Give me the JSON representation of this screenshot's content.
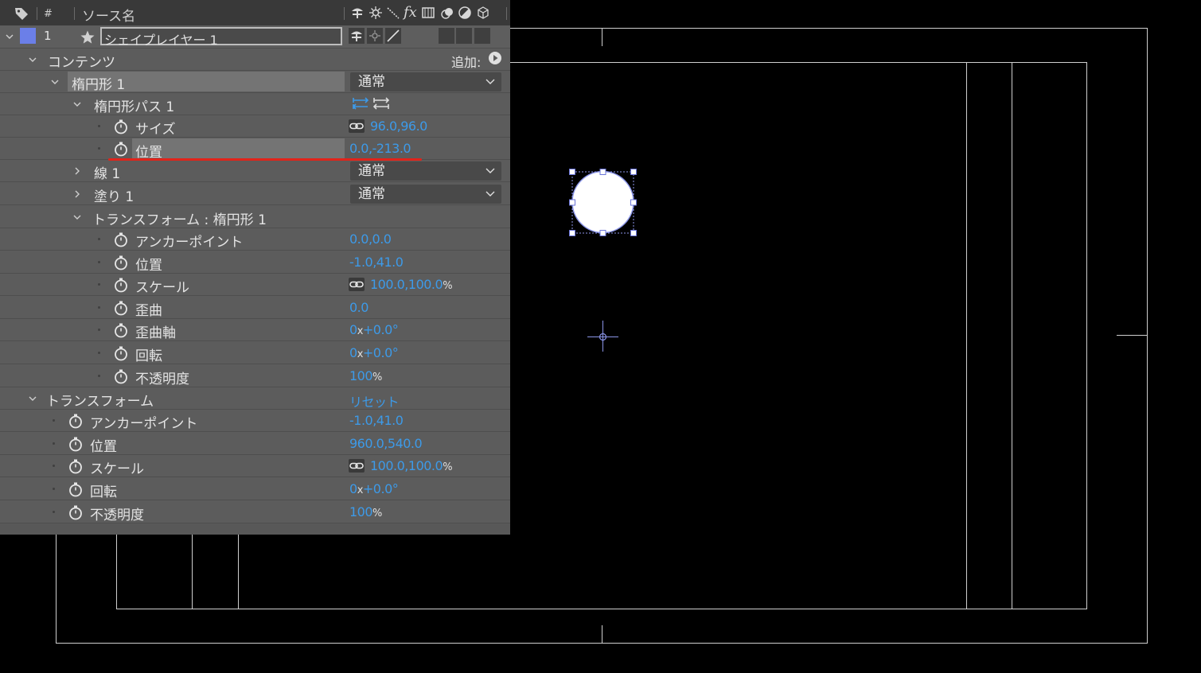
{
  "header": {
    "num_label": "#",
    "source_label": "ソース名"
  },
  "layer": {
    "number": "1",
    "name": "シェイプレイヤー 1",
    "color": "#6b7fe8"
  },
  "contents": {
    "label": "コンテンツ",
    "add_label": "追加:",
    "ellipse_group": {
      "label": "楕円形 1",
      "blend_mode": "通常",
      "path": {
        "label": "楕円形パス 1",
        "size_label": "サイズ",
        "size_value": "96.0,96.0",
        "position_label": "位置",
        "position_value": "0.0,-213.0"
      },
      "stroke": {
        "label": "線 1",
        "blend_mode": "通常"
      },
      "fill": {
        "label": "塗り 1",
        "blend_mode": "通常"
      },
      "transform": {
        "label": "トランスフォーム : 楕円形 1",
        "anchor_label": "アンカーポイント",
        "anchor_value": "0.0,0.0",
        "position_label": "位置",
        "position_value": "-1.0,41.0",
        "scale_label": "スケール",
        "scale_value": "100.0,100.0",
        "skew_label": "歪曲",
        "skew_value": "0.0",
        "skew_axis_label": "歪曲軸",
        "skew_axis_turns": "0",
        "skew_axis_deg": "+0.0°",
        "rotation_label": "回転",
        "rotation_turns": "0",
        "rotation_deg": "+0.0°",
        "opacity_label": "不透明度",
        "opacity_value": "100"
      }
    }
  },
  "layer_transform": {
    "label": "トランスフォーム",
    "reset_label": "リセット",
    "anchor_label": "アンカーポイント",
    "anchor_value": "-1.0,41.0",
    "position_label": "位置",
    "position_value": "960.0,540.0",
    "scale_label": "スケール",
    "scale_value": "100.0,100.0",
    "rotation_label": "回転",
    "rotation_turns": "0",
    "rotation_deg": "+0.0°",
    "opacity_label": "不透明度",
    "opacity_value": "100"
  },
  "units": {
    "percent": "%",
    "times": "x"
  },
  "colors": {
    "panel_bg": "#5c5c5c",
    "header_bg": "#393939",
    "value_blue": "#3d9ae8",
    "highlight_red": "#e2231a",
    "selection_blue": "#8b95e8"
  },
  "icons": [
    "tag-icon",
    "star-icon",
    "stopwatch-icon",
    "link-icon",
    "add-circle-icon",
    "chevron-down-icon",
    "twirl-open-icon",
    "twirl-closed-icon",
    "fx-icon"
  ]
}
